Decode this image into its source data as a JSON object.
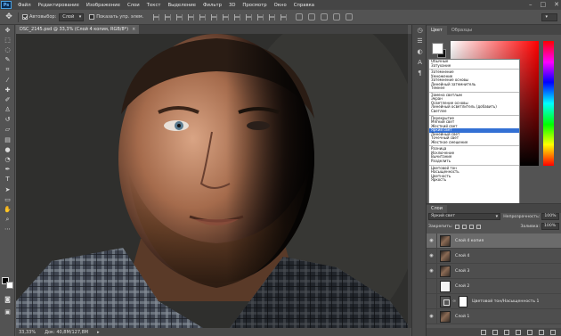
{
  "menubar": {
    "logo": "Ps",
    "items": [
      "Файл",
      "Редактирование",
      "Изображение",
      "Слои",
      "Текст",
      "Выделение",
      "Фильтр",
      "3D",
      "Просмотр",
      "Окно",
      "Справка"
    ]
  },
  "options": {
    "auto_select_label": "Автовыбор:",
    "auto_select_checked": true,
    "auto_select_value": "Слой",
    "show_transform_label": "Показать упр. элем.",
    "show_transform_checked": false
  },
  "document": {
    "tab_title": "DSC_2145.psd @ 33,3% (Слой 4 копия, RGB/8*)",
    "tab_close": "×",
    "zoom": "33,33%",
    "doc_info": "Док: 40,8M/127,8M"
  },
  "color_panel": {
    "tabs": [
      "Цвет",
      "Образцы"
    ],
    "active_tab": "Цвет",
    "foreground": "#ffffff",
    "background": "#111111"
  },
  "blend_dropdown": {
    "groups": [
      [
        "Обычные",
        "Затухание"
      ],
      [
        "Затемнение",
        "Умножение",
        "Затемнение основы",
        "Линейный затемнитель",
        "Темнее"
      ],
      [
        "Замена светлым",
        "Экран",
        "Осветление основы",
        "Линейный осветлитель (добавить)",
        "Светлее"
      ],
      [
        "Перекрытие",
        "Мягкий свет",
        "Жесткий свет",
        "Яркий свет",
        "Линейный свет",
        "Точечный свет",
        "Жесткое смешение"
      ],
      [
        "Разница",
        "Исключение",
        "Вычитание",
        "Разделить"
      ],
      [
        "Цветовой тон",
        "Насыщенность",
        "Цветность",
        "Яркость"
      ]
    ],
    "selected": "Яркий свет"
  },
  "layers_panel": {
    "tab": "Слои",
    "blend_mode": "Яркий свет",
    "opacity_label": "Непрозрачность:",
    "opacity_value": "100%",
    "lock_label": "Закрепить:",
    "fill_label": "Заливка:",
    "fill_value": "100%",
    "layers": [
      {
        "name": "Слой 4 копия",
        "thumb": "photo",
        "active": true
      },
      {
        "name": "Слой 4",
        "thumb": "photo",
        "active": false
      },
      {
        "name": "Слой 3",
        "thumb": "photo",
        "active": false
      },
      {
        "name": "Слой 2",
        "thumb": "white",
        "active": false
      },
      {
        "name": "Цветовой тон/Насыщенность 1",
        "thumb": "adj",
        "active": false
      },
      {
        "name": "Слой 1",
        "thumb": "photo",
        "active": false
      }
    ]
  }
}
